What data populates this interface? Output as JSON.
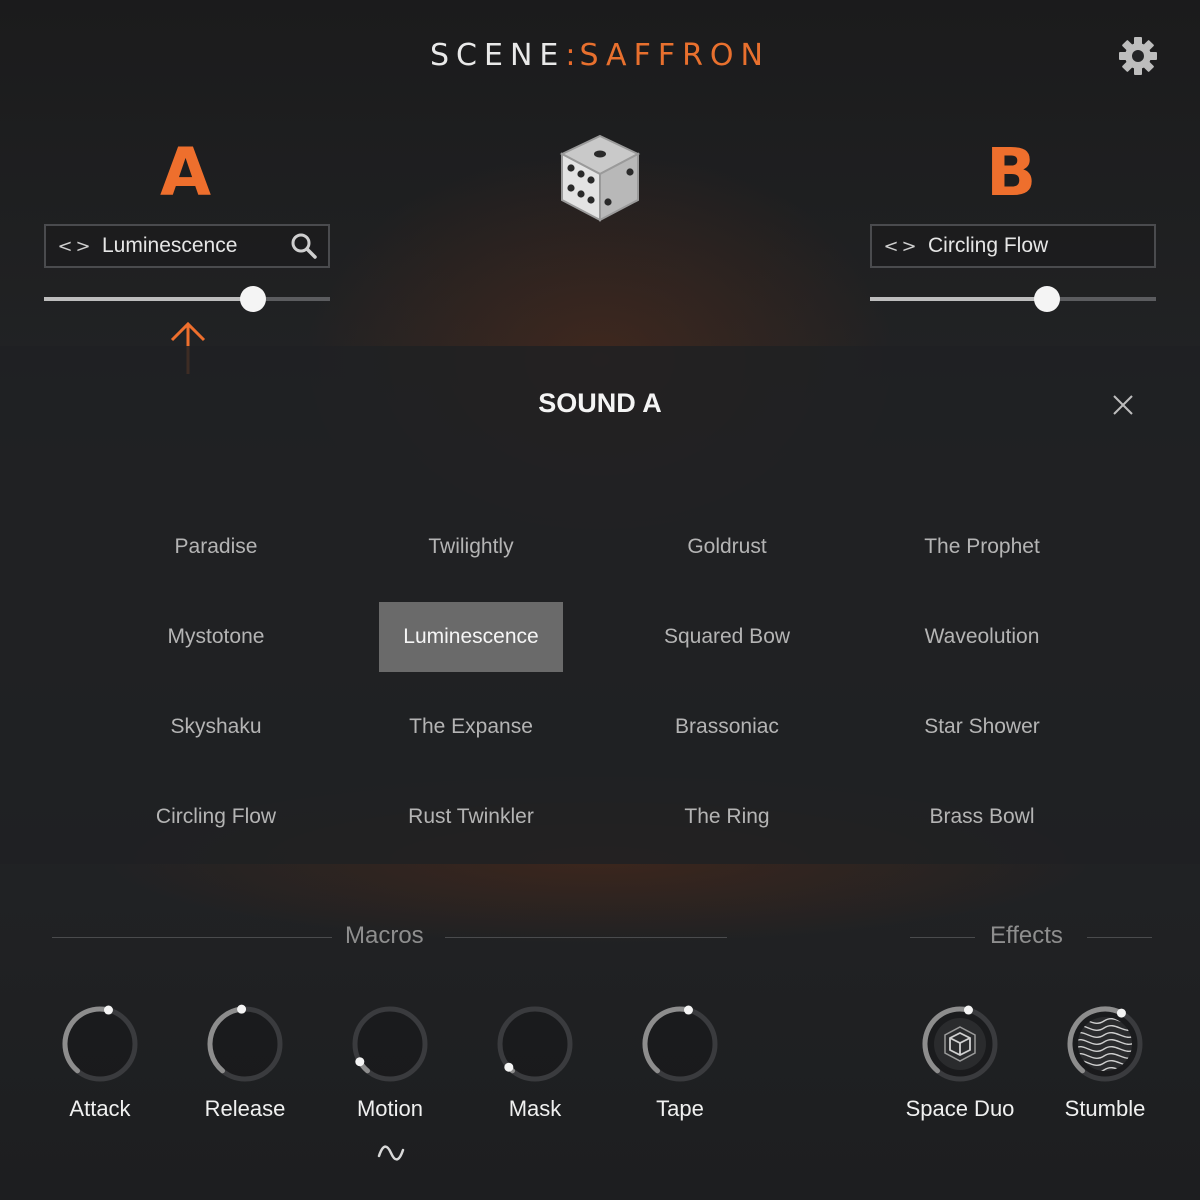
{
  "header": {
    "brand_left": "SCENE",
    "brand_sep": ":",
    "brand_right": "SAFFRON",
    "settings_icon": "gear-icon"
  },
  "layer_a": {
    "letter": "A",
    "preset": "Luminescence",
    "prev_glyph": "<",
    "next_glyph": ">",
    "search_icon": "search-icon",
    "level": 0.73
  },
  "layer_b": {
    "letter": "B",
    "preset": "Circling Flow",
    "prev_glyph": "<",
    "next_glyph": ">",
    "level": 0.62
  },
  "randomize_icon": "dice-icon",
  "modal": {
    "title": "SOUND A",
    "close_icon": "close-icon",
    "selected": "Luminescence",
    "presets": [
      [
        "Paradise",
        "Twilightly",
        "Goldrust",
        "The Prophet"
      ],
      [
        "Mystotone",
        "Luminescence",
        "Squared Bow",
        "Waveolution"
      ],
      [
        "Skyshaku",
        "The Expanse",
        "Brassoniac",
        "Star Shower"
      ],
      [
        "Circling Flow",
        "Rust Twinkler",
        "The Ring",
        "Brass Bowl"
      ]
    ]
  },
  "macros": {
    "title": "Macros",
    "knobs": [
      {
        "label": "Attack",
        "value": 0.55
      },
      {
        "label": "Release",
        "value": 0.48
      },
      {
        "label": "Motion",
        "value": 0.07
      },
      {
        "label": "Mask",
        "value": 0.03
      },
      {
        "label": "Tape",
        "value": 0.55
      }
    ],
    "motion_mod_icon": "lfo-wave-icon"
  },
  "effects": {
    "title": "Effects",
    "knobs": [
      {
        "label": "Space Duo",
        "value": 0.55,
        "icon": "cube-icon"
      },
      {
        "label": "Stumble",
        "value": 0.6,
        "icon": "wave-lines-icon"
      }
    ]
  },
  "colors": {
    "accent": "#ee6f2d",
    "background": "#1f2022",
    "modal": "#222325",
    "selected_cell": "#6a6a6a"
  }
}
